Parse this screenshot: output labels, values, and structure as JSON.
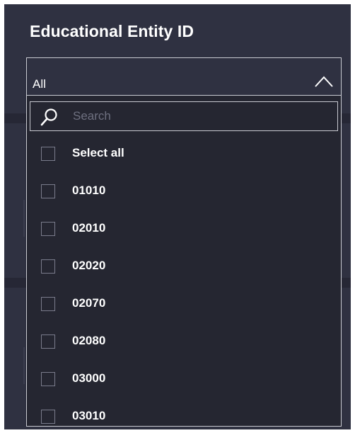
{
  "slicer": {
    "title": "Educational Entity ID",
    "selected_value": "All",
    "search": {
      "placeholder": "Search"
    },
    "options": [
      "Select all",
      "01010",
      "02010",
      "02020",
      "02070",
      "02080",
      "03000",
      "03010"
    ]
  },
  "icons": {
    "dropdown_toggle": "chevron-up-icon",
    "search": "search-icon"
  },
  "colors": {
    "panel_background": "#2f3141",
    "list_background": "#252631",
    "border": "#c9cad1",
    "text": "#ffffff",
    "placeholder": "#6e7080",
    "checkbox_border": "#7a7c8c"
  }
}
